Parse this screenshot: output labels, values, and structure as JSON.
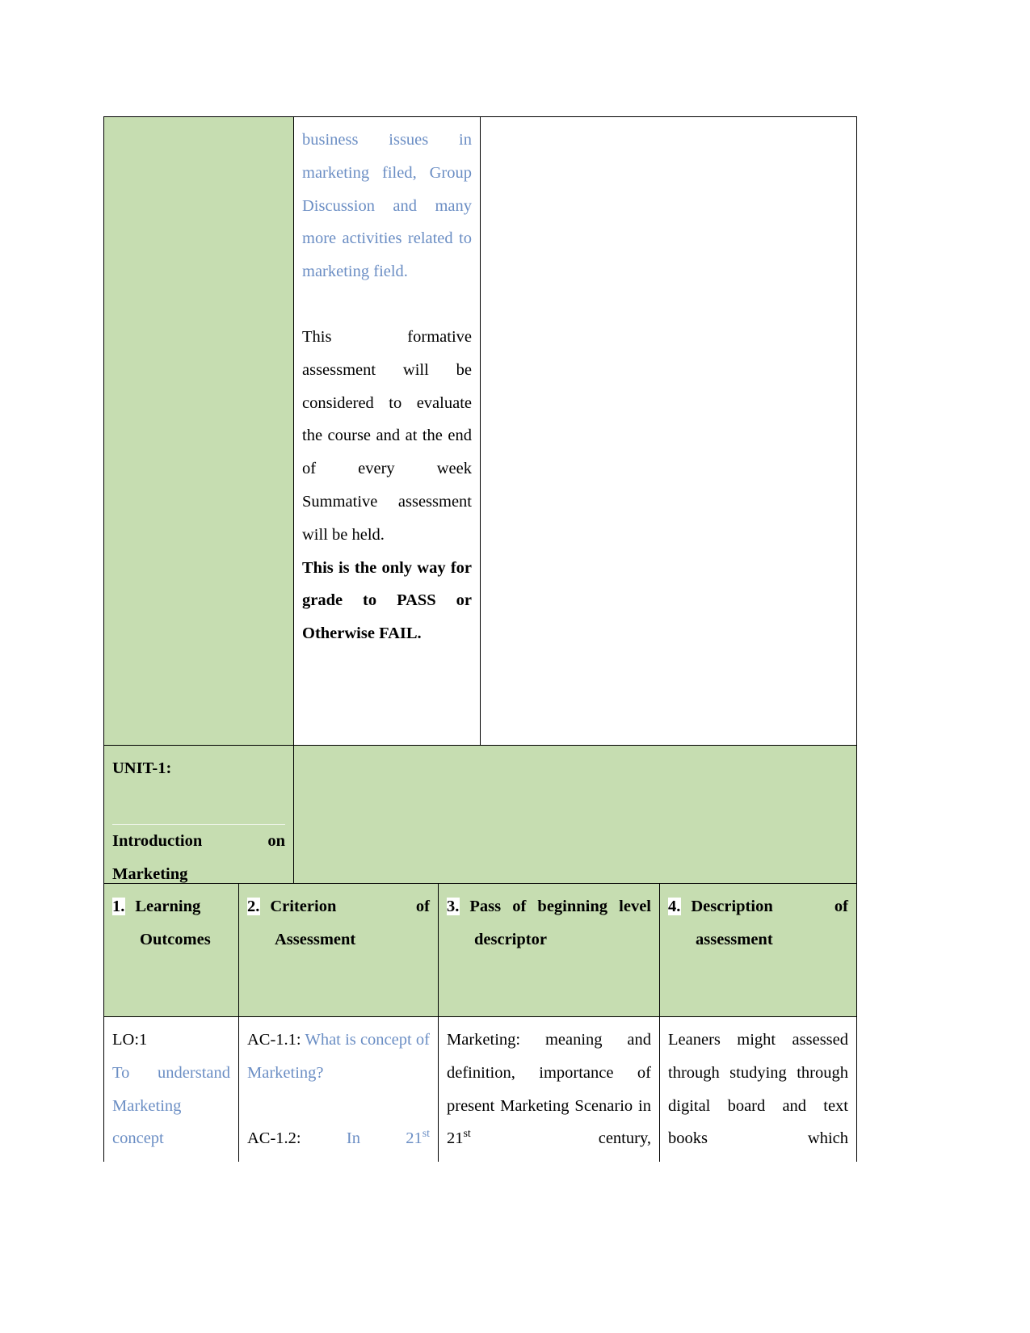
{
  "document": {
    "type": "course-assessment-table",
    "accent_green": "#c6ddb1",
    "blue_text": "#6b8ec4",
    "black_text": "#000000"
  },
  "row_continued": {
    "left_cell": "",
    "middle_cell": {
      "para1": "business issues in marketing filed, Group Discussion and many more activities related to marketing field.",
      "para2": "This formative assessment will be considered to evaluate the course and at the end of every week Summative assessment will be held.",
      "para3": "This is the only way for grade to PASS or Otherwise FAIL."
    },
    "right_cell": ""
  },
  "unit_row": {
    "title": "UNIT-1:",
    "subtitle": "Introduction on Marketing",
    "right_cell": ""
  },
  "header_row": {
    "columns": [
      {
        "number": "1.",
        "label": "Learning Outcomes"
      },
      {
        "number": "2.",
        "label": "Criterion of Assessment"
      },
      {
        "number": "3.",
        "label": "Pass of beginning level descriptor"
      },
      {
        "number": "4.",
        "label": "Description of assessment"
      }
    ]
  },
  "body_row": {
    "col1": {
      "code": "LO:1",
      "text": "To understand Marketing concept"
    },
    "col2": {
      "code1": "AC-1.1:",
      "text1": "What is concept of Marketing?",
      "code2": "AC-1.2:",
      "text2_pre": "In 21",
      "text2_sup": "st"
    },
    "col3": {
      "line1": "Marketing: meaning and definition, importance of present Marketing Scenario in 21",
      "sup": "st",
      "line1_post": " century,"
    },
    "col4": {
      "text": "Leaners might assessed through studying through digital board and text books which"
    }
  }
}
